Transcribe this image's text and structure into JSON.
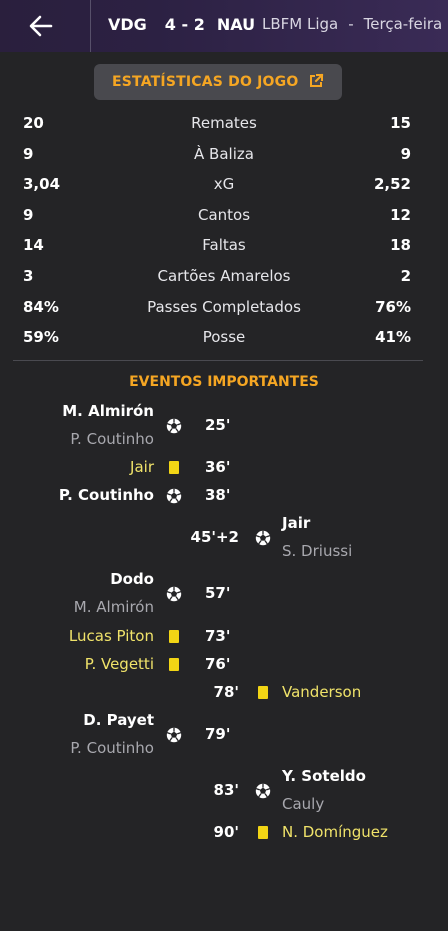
{
  "header": {
    "home_team": "VDG",
    "score": "4 - 2",
    "away_team": "NAU",
    "league": "LBFM Liga",
    "separator": "-",
    "day": "Terça-feira"
  },
  "stats_button": {
    "label": "ESTATÍSTICAS DO JOGO"
  },
  "stats": [
    {
      "home": "20",
      "label": "Remates",
      "away": "15"
    },
    {
      "home": "9",
      "label": "À Baliza",
      "away": "9"
    },
    {
      "home": "3,04",
      "label": "xG",
      "away": "2,52"
    },
    {
      "home": "9",
      "label": "Cantos",
      "away": "12"
    },
    {
      "home": "14",
      "label": "Faltas",
      "away": "18"
    },
    {
      "home": "3",
      "label": "Cartões Amarelos",
      "away": "2"
    },
    {
      "home": "84%",
      "label": "Passes Completados",
      "away": "76%"
    },
    {
      "home": "59%",
      "label": "Posse",
      "away": "41%"
    }
  ],
  "events_title": "EVENTOS IMPORTANTES",
  "events": [
    {
      "side": "home",
      "type": "goal",
      "minute": "25'",
      "player": "M. Almirón",
      "assist": "P. Coutinho"
    },
    {
      "side": "home",
      "type": "yellow",
      "minute": "36'",
      "player": "Jair"
    },
    {
      "side": "home",
      "type": "goal",
      "minute": "38'",
      "player": "P. Coutinho"
    },
    {
      "side": "away",
      "type": "goal",
      "minute": "45'+2",
      "player": "Jair",
      "assist": "S. Driussi"
    },
    {
      "side": "home",
      "type": "goal",
      "minute": "57'",
      "player": "Dodo",
      "assist": "M. Almirón"
    },
    {
      "side": "home",
      "type": "yellow",
      "minute": "73'",
      "player": "Lucas Piton"
    },
    {
      "side": "home",
      "type": "yellow",
      "minute": "76'",
      "player": "P. Vegetti"
    },
    {
      "side": "away",
      "type": "yellow",
      "minute": "78'",
      "player": "Vanderson"
    },
    {
      "side": "home",
      "type": "goal",
      "minute": "79'",
      "player": "D. Payet",
      "assist": "P. Coutinho"
    },
    {
      "side": "away",
      "type": "goal",
      "minute": "83'",
      "player": "Y. Soteldo",
      "assist": "Cauly"
    },
    {
      "side": "away",
      "type": "yellow",
      "minute": "90'",
      "player": "N. Domínguez"
    }
  ],
  "colors": {
    "accent": "#f5a623",
    "yellow_card": "#f2d515",
    "background": "#242426",
    "header": "#2c2143"
  },
  "icons": {
    "back": "arrow-left-icon",
    "open": "external-link-icon",
    "goal": "soccer-ball-icon",
    "card": "yellow-card-icon"
  }
}
